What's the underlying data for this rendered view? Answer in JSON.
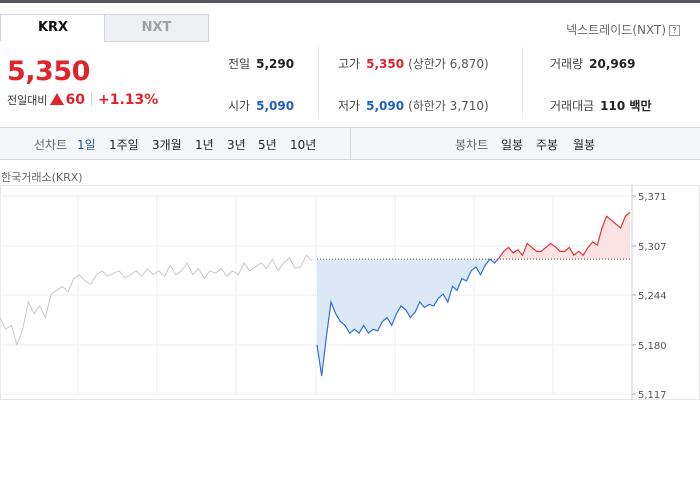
{
  "tabs": [
    {
      "label": "KRX",
      "active": true
    },
    {
      "label": "NXT",
      "active": false
    }
  ],
  "nxt_link": "넥스트레이드(NXT)",
  "quote": {
    "price": "5,350",
    "change_label": "전일대비",
    "change": "60",
    "change_pct": "+1.13%"
  },
  "stats": {
    "prev_close": {
      "label": "전일",
      "value": "5,290"
    },
    "open": {
      "label": "시가",
      "value": "5,090"
    },
    "high": {
      "label": "고가",
      "value": "5,350",
      "note": "(상한가 6,870)"
    },
    "low": {
      "label": "저가",
      "value": "5,090",
      "note": "(하한가 3,710)"
    },
    "volume": {
      "label": "거래량",
      "value": "20,969"
    },
    "turnover": {
      "label": "거래대금",
      "value": "110 백만"
    }
  },
  "toolbar": {
    "line_label": "선차트",
    "line_periods": [
      "1일",
      "1주일",
      "3개월",
      "1년",
      "3년",
      "5년",
      "10년"
    ],
    "active_period": "1일",
    "candle_label": "봉차트",
    "candle_periods": [
      "일봉",
      "주봉",
      "월봉"
    ]
  },
  "chart_data": {
    "type": "line",
    "title": "한국거래소(KRX)",
    "y_ticks": [
      "5,371",
      "5,307",
      "5,244",
      "5,180",
      "5,117"
    ],
    "ylim": [
      5117,
      5371
    ],
    "baseline": 5290,
    "colors": {
      "up": "#e0343a",
      "down": "#2f6fd6",
      "prior": "#c8c8c8",
      "up_fill": "#fbe3e4",
      "down_fill": "#dce8f8"
    },
    "prior_day": [
      5215,
      5200,
      5205,
      5180,
      5200,
      5235,
      5220,
      5230,
      5215,
      5245,
      5250,
      5255,
      5248,
      5265,
      5270,
      5262,
      5258,
      5270,
      5275,
      5268,
      5272,
      5275,
      5266,
      5270,
      5275,
      5268,
      5278,
      5270,
      5275,
      5268,
      5282,
      5270,
      5275,
      5285,
      5270,
      5278,
      5265,
      5275,
      5272,
      5278,
      5268,
      5275,
      5270,
      5285,
      5275,
      5280,
      5285,
      5278,
      5290,
      5275,
      5285,
      5292,
      5278,
      5280,
      5295,
      5288
    ],
    "today": [
      5180,
      5140,
      5190,
      5235,
      5220,
      5210,
      5205,
      5195,
      5200,
      5195,
      5205,
      5195,
      5200,
      5198,
      5210,
      5215,
      5205,
      5220,
      5230,
      5225,
      5215,
      5222,
      5235,
      5228,
      5232,
      5230,
      5240,
      5245,
      5235,
      5255,
      5250,
      5265,
      5262,
      5275,
      5280,
      5270,
      5282,
      5290,
      5285,
      5292,
      5300,
      5305,
      5298,
      5302,
      5295,
      5310,
      5305,
      5300,
      5300,
      5305,
      5310,
      5306,
      5300,
      5300,
      5305,
      5295,
      5300,
      5295,
      5305,
      5312,
      5308,
      5330,
      5345,
      5340,
      5335,
      5330,
      5345,
      5350
    ]
  }
}
